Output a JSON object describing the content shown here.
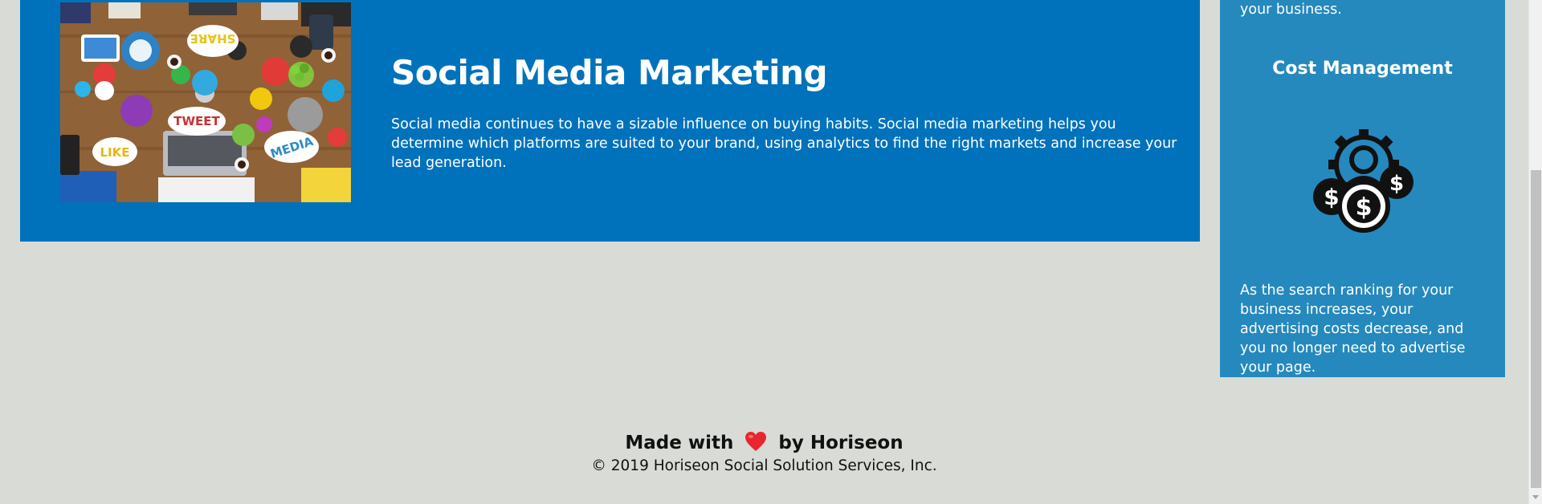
{
  "service": {
    "title": "Social Media Marketing",
    "body": "Social media continues to have a sizable influence on buying habits. Social media marketing helps you determine which platforms are suited to your brand, using analytics to find the right markets and increase your lead generation.",
    "image_words": [
      "SHARE",
      "TWEET",
      "LIKE",
      "MEDIA"
    ]
  },
  "benefits": {
    "prev_text_tail": "your business.",
    "title": "Cost Management",
    "icon": "cost-management-icon",
    "text": "As the search ranking for your business increases, your advertising costs decrease, and you no longer need to advertise your page."
  },
  "footer": {
    "made_prefix": "Made with",
    "heart_icon": "heart-icon",
    "made_suffix": "by Horiseon",
    "copyright": "© 2019 Horiseon Social Solution Services, Inc."
  },
  "colors": {
    "page_bg": "#d9dcd6",
    "card_bg": "#0072bb",
    "sidebar_bg": "#2589bd",
    "heart": "#e8262e"
  }
}
